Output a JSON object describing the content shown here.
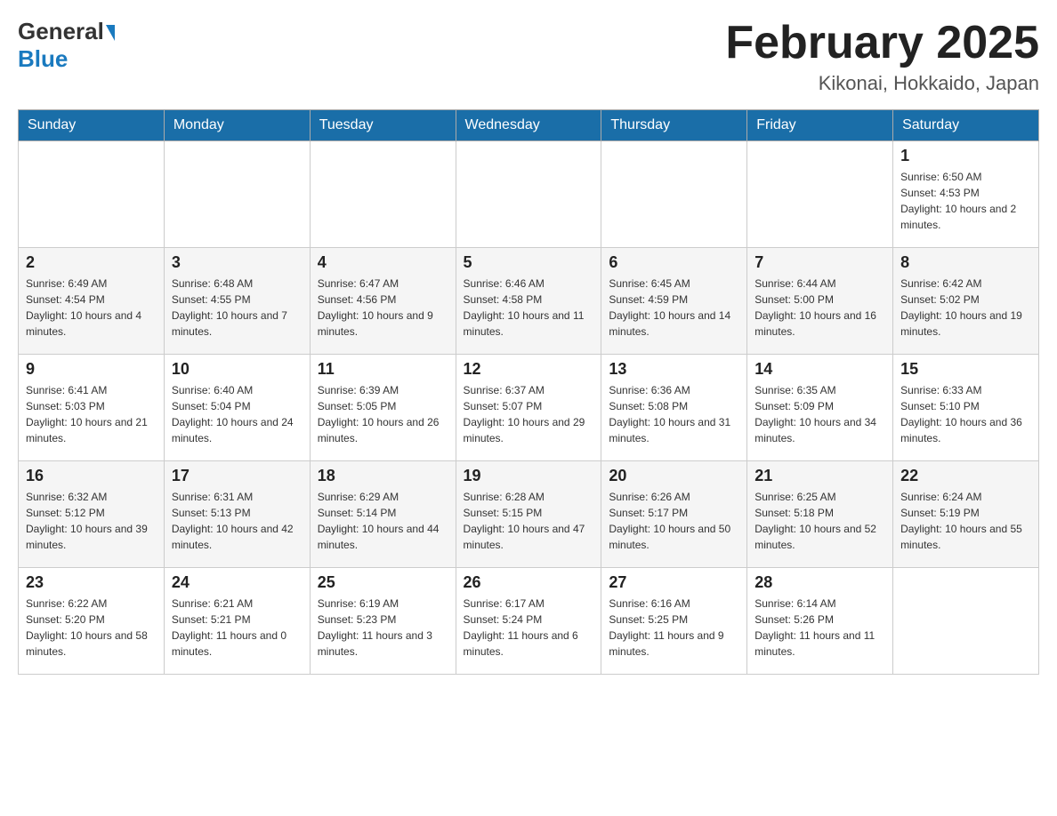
{
  "header": {
    "logo_general": "General",
    "logo_blue": "Blue",
    "month_title": "February 2025",
    "location": "Kikonai, Hokkaido, Japan"
  },
  "weekdays": [
    "Sunday",
    "Monday",
    "Tuesday",
    "Wednesday",
    "Thursday",
    "Friday",
    "Saturday"
  ],
  "weeks": [
    [
      {
        "day": "",
        "info": ""
      },
      {
        "day": "",
        "info": ""
      },
      {
        "day": "",
        "info": ""
      },
      {
        "day": "",
        "info": ""
      },
      {
        "day": "",
        "info": ""
      },
      {
        "day": "",
        "info": ""
      },
      {
        "day": "1",
        "info": "Sunrise: 6:50 AM\nSunset: 4:53 PM\nDaylight: 10 hours and 2 minutes."
      }
    ],
    [
      {
        "day": "2",
        "info": "Sunrise: 6:49 AM\nSunset: 4:54 PM\nDaylight: 10 hours and 4 minutes."
      },
      {
        "day": "3",
        "info": "Sunrise: 6:48 AM\nSunset: 4:55 PM\nDaylight: 10 hours and 7 minutes."
      },
      {
        "day": "4",
        "info": "Sunrise: 6:47 AM\nSunset: 4:56 PM\nDaylight: 10 hours and 9 minutes."
      },
      {
        "day": "5",
        "info": "Sunrise: 6:46 AM\nSunset: 4:58 PM\nDaylight: 10 hours and 11 minutes."
      },
      {
        "day": "6",
        "info": "Sunrise: 6:45 AM\nSunset: 4:59 PM\nDaylight: 10 hours and 14 minutes."
      },
      {
        "day": "7",
        "info": "Sunrise: 6:44 AM\nSunset: 5:00 PM\nDaylight: 10 hours and 16 minutes."
      },
      {
        "day": "8",
        "info": "Sunrise: 6:42 AM\nSunset: 5:02 PM\nDaylight: 10 hours and 19 minutes."
      }
    ],
    [
      {
        "day": "9",
        "info": "Sunrise: 6:41 AM\nSunset: 5:03 PM\nDaylight: 10 hours and 21 minutes."
      },
      {
        "day": "10",
        "info": "Sunrise: 6:40 AM\nSunset: 5:04 PM\nDaylight: 10 hours and 24 minutes."
      },
      {
        "day": "11",
        "info": "Sunrise: 6:39 AM\nSunset: 5:05 PM\nDaylight: 10 hours and 26 minutes."
      },
      {
        "day": "12",
        "info": "Sunrise: 6:37 AM\nSunset: 5:07 PM\nDaylight: 10 hours and 29 minutes."
      },
      {
        "day": "13",
        "info": "Sunrise: 6:36 AM\nSunset: 5:08 PM\nDaylight: 10 hours and 31 minutes."
      },
      {
        "day": "14",
        "info": "Sunrise: 6:35 AM\nSunset: 5:09 PM\nDaylight: 10 hours and 34 minutes."
      },
      {
        "day": "15",
        "info": "Sunrise: 6:33 AM\nSunset: 5:10 PM\nDaylight: 10 hours and 36 minutes."
      }
    ],
    [
      {
        "day": "16",
        "info": "Sunrise: 6:32 AM\nSunset: 5:12 PM\nDaylight: 10 hours and 39 minutes."
      },
      {
        "day": "17",
        "info": "Sunrise: 6:31 AM\nSunset: 5:13 PM\nDaylight: 10 hours and 42 minutes."
      },
      {
        "day": "18",
        "info": "Sunrise: 6:29 AM\nSunset: 5:14 PM\nDaylight: 10 hours and 44 minutes."
      },
      {
        "day": "19",
        "info": "Sunrise: 6:28 AM\nSunset: 5:15 PM\nDaylight: 10 hours and 47 minutes."
      },
      {
        "day": "20",
        "info": "Sunrise: 6:26 AM\nSunset: 5:17 PM\nDaylight: 10 hours and 50 minutes."
      },
      {
        "day": "21",
        "info": "Sunrise: 6:25 AM\nSunset: 5:18 PM\nDaylight: 10 hours and 52 minutes."
      },
      {
        "day": "22",
        "info": "Sunrise: 6:24 AM\nSunset: 5:19 PM\nDaylight: 10 hours and 55 minutes."
      }
    ],
    [
      {
        "day": "23",
        "info": "Sunrise: 6:22 AM\nSunset: 5:20 PM\nDaylight: 10 hours and 58 minutes."
      },
      {
        "day": "24",
        "info": "Sunrise: 6:21 AM\nSunset: 5:21 PM\nDaylight: 11 hours and 0 minutes."
      },
      {
        "day": "25",
        "info": "Sunrise: 6:19 AM\nSunset: 5:23 PM\nDaylight: 11 hours and 3 minutes."
      },
      {
        "day": "26",
        "info": "Sunrise: 6:17 AM\nSunset: 5:24 PM\nDaylight: 11 hours and 6 minutes."
      },
      {
        "day": "27",
        "info": "Sunrise: 6:16 AM\nSunset: 5:25 PM\nDaylight: 11 hours and 9 minutes."
      },
      {
        "day": "28",
        "info": "Sunrise: 6:14 AM\nSunset: 5:26 PM\nDaylight: 11 hours and 11 minutes."
      },
      {
        "day": "",
        "info": ""
      }
    ]
  ]
}
